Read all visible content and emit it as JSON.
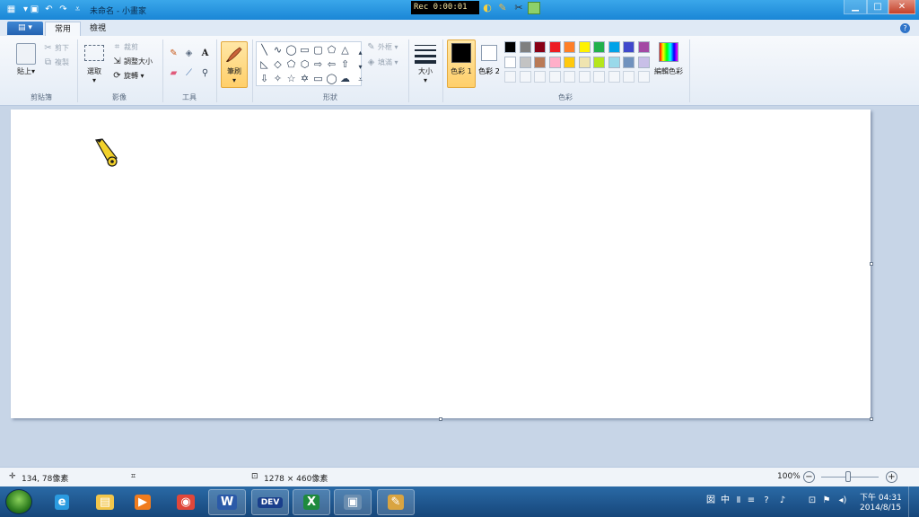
{
  "window": {
    "title": "未命名 - 小畫家",
    "qat_icons": [
      "paint-app-icon",
      "save-icon",
      "undo-icon",
      "redo-icon",
      "customize-dropdown-icon"
    ]
  },
  "recorder": {
    "timer": "Rec 0:00:01"
  },
  "window_controls": {
    "minimize": "▁",
    "maximize": "□",
    "close": "✕"
  },
  "file_menu": {
    "label": "▤ ▾"
  },
  "tabs": [
    {
      "label": "常用",
      "active": true
    },
    {
      "label": "檢視",
      "active": false
    }
  ],
  "help": {
    "label": "?"
  },
  "ribbon": {
    "clipboard": {
      "group_label": "剪貼簿",
      "paste_label": "貼上",
      "paste_arrow": "▾",
      "cut_label": "剪下",
      "copy_label": "複製"
    },
    "image": {
      "group_label": "影像",
      "select_label": "選取",
      "select_arrow": "▾",
      "crop_label": "裁剪",
      "resize_label": "調整大小",
      "rotate_label": "旋轉 ▾"
    },
    "tools": {
      "group_label": "工具"
    },
    "brushes": {
      "label": "筆刷",
      "arrow": "▾"
    },
    "shapes": {
      "group_label": "形狀",
      "outline_label": "外框 ▾",
      "fill_label": "填滿 ▾"
    },
    "size": {
      "label": "大小",
      "arrow": "▾"
    },
    "colors": {
      "group_label": "色彩",
      "color1_label": "色彩 1",
      "color2_label": "色彩 2",
      "edit_colors_label": "編輯色彩",
      "palette_row1": [
        "#000000",
        "#7f7f7f",
        "#880015",
        "#ed1c24",
        "#ff7f27",
        "#fff200",
        "#22b14c",
        "#00a2e8",
        "#3f48cc",
        "#a349a4"
      ],
      "palette_row2": [
        "#ffffff",
        "#c3c3c3",
        "#b97a57",
        "#ffaec9",
        "#ffc90e",
        "#efe4b0",
        "#b5e61d",
        "#99d9ea",
        "#7092be",
        "#c8bfe7"
      ]
    }
  },
  "status": {
    "cursor_pos": "134, 78像素",
    "image_size": "1278 × 460像素",
    "zoom": "100%"
  },
  "taskbar": {
    "clock_time": "下午 04:31",
    "clock_date": "2014/8/15",
    "ime_label": "中",
    "tray_chars": [
      "囡",
      "中",
      "Ⅱ",
      "≡",
      "?",
      "♪",
      "⊡",
      "⚑",
      "◂)"
    ],
    "apps": [
      {
        "name": "ie",
        "glyph": "e",
        "color": "#2b9be0"
      },
      {
        "name": "explorer",
        "glyph": "▤",
        "color": "#f3c64b"
      },
      {
        "name": "media-player",
        "glyph": "▶",
        "color": "#f07c1e"
      },
      {
        "name": "chrome",
        "glyph": "◉",
        "color": "#e0473a"
      },
      {
        "name": "word",
        "glyph": "W",
        "color": "#2b5aa8"
      },
      {
        "name": "dev-cpp",
        "glyph": "DEV",
        "color": "#1a3f8c"
      },
      {
        "name": "excel",
        "glyph": "X",
        "color": "#1e8a3d"
      },
      {
        "name": "window",
        "glyph": "▣",
        "color": "#6b8eb0"
      },
      {
        "name": "paint",
        "glyph": "✎",
        "color": "#d9a441"
      }
    ]
  }
}
